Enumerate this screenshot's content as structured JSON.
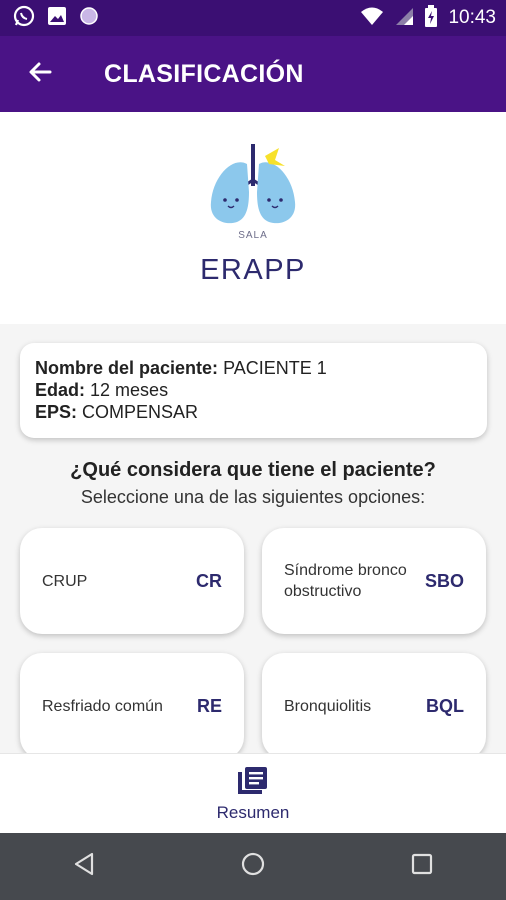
{
  "status_bar": {
    "time": "10:43",
    "icons": [
      "whatsapp-icon",
      "image-icon",
      "circle-app-icon",
      "wifi-icon",
      "signal-icon",
      "battery-icon"
    ]
  },
  "app_bar": {
    "title": "CLASIFICACIÓN",
    "back_icon": "arrow-back-icon"
  },
  "logo": {
    "small_text": "SALA",
    "big_text": "ERAPP"
  },
  "patient": {
    "name_label": "Nombre del paciente:",
    "name_value": "PACIENTE 1",
    "age_label": "Edad:",
    "age_value": "12 meses",
    "eps_label": "EPS:",
    "eps_value": "COMPENSAR"
  },
  "question": "¿Qué considera que tiene el paciente?",
  "instruction": "Seleccione una de las siguientes opciones:",
  "options": [
    {
      "label": "CRUP",
      "code": "CR"
    },
    {
      "label": "Síndrome broncoobstructivo",
      "code": "SBO"
    },
    {
      "label": "Resfriado común",
      "code": "RE"
    },
    {
      "label": "Bronquiolitis",
      "code": "BQL"
    }
  ],
  "bottom_nav": {
    "label": "Resumen",
    "icon": "summary-list-icon"
  },
  "colors": {
    "status_bar": "#3b0f73",
    "app_bar": "#4a1386",
    "accent_text": "#2d2a6e",
    "system_nav": "#46494e"
  }
}
